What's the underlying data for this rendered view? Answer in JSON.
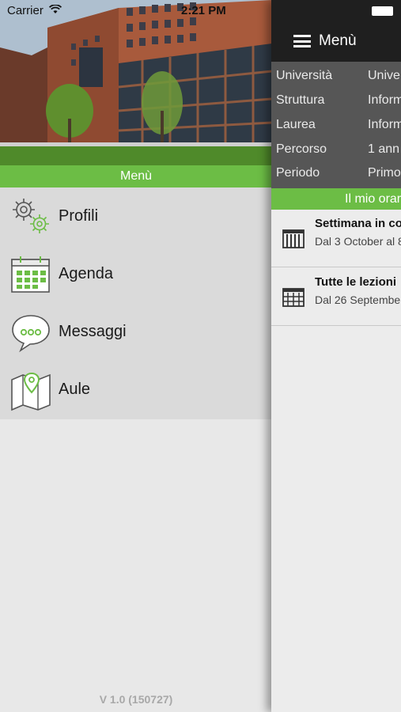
{
  "status_bar": {
    "carrier": "Carrier",
    "time": "2:21 PM"
  },
  "drawer": {
    "header_label": "Menù",
    "items": [
      {
        "label": "Profili",
        "icon": "gears-icon"
      },
      {
        "label": "Agenda",
        "icon": "calendar-icon"
      },
      {
        "label": "Messaggi",
        "icon": "chat-bubble-icon"
      },
      {
        "label": "Aule",
        "icon": "map-pin-icon"
      }
    ],
    "version": "V 1.0 (150727)"
  },
  "main": {
    "nav_title": "Menù",
    "info_rows": [
      {
        "key": "Università",
        "value": "Unive"
      },
      {
        "key": "Struttura",
        "value": "Inform"
      },
      {
        "key": "Laurea",
        "value": "Inform"
      },
      {
        "key": "Percorso",
        "value": "1 ann"
      },
      {
        "key": "Periodo",
        "value": "Primo"
      }
    ],
    "section_label": "Il mio orar",
    "cards": [
      {
        "title": "Settimana in co",
        "subtitle": "Dal 3 October al 8"
      },
      {
        "title": "Tutte le lezioni",
        "subtitle": "Dal 26 Septembe"
      }
    ]
  },
  "colors": {
    "accent_green": "#6cbd45",
    "dark_header": "#1f1f1f",
    "info_grey": "#565656"
  }
}
